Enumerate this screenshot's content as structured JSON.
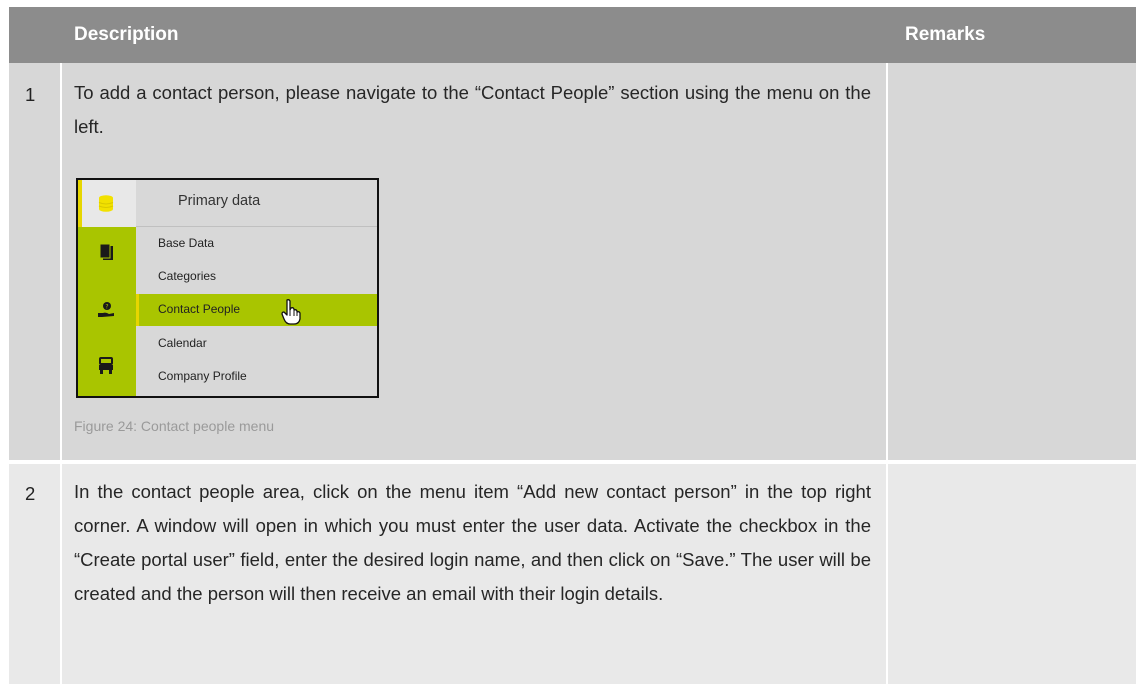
{
  "header": {
    "description": "Description",
    "remarks": "Remarks"
  },
  "rows": [
    {
      "number": "1",
      "text": "To add a contact person, please navigate to the “Contact People” section using the menu on the left.",
      "figure": {
        "menu_title": "Primary data",
        "items": [
          "Base Data",
          "Categories",
          "Contact People",
          "Calendar",
          "Company Profile"
        ],
        "active_item": "Contact People",
        "side_icons": [
          "database-icon",
          "documents-icon",
          "contact-hand-icon",
          "truck-icon"
        ],
        "accent": "#a9c500",
        "highlight": "#e6d600",
        "cursor_icon": "hand-pointer-icon"
      },
      "caption": "Figure 24: Contact people menu"
    },
    {
      "number": "2",
      "text": "In the contact people area, click on the menu item “Add new contact person” in the top right corner. A window will open in which you must enter the user data. Activate the checkbox in the “Create portal user” field, enter the desired login name, and then click on “Save.” The user will be created and the person will then receive an email with their login details."
    }
  ]
}
